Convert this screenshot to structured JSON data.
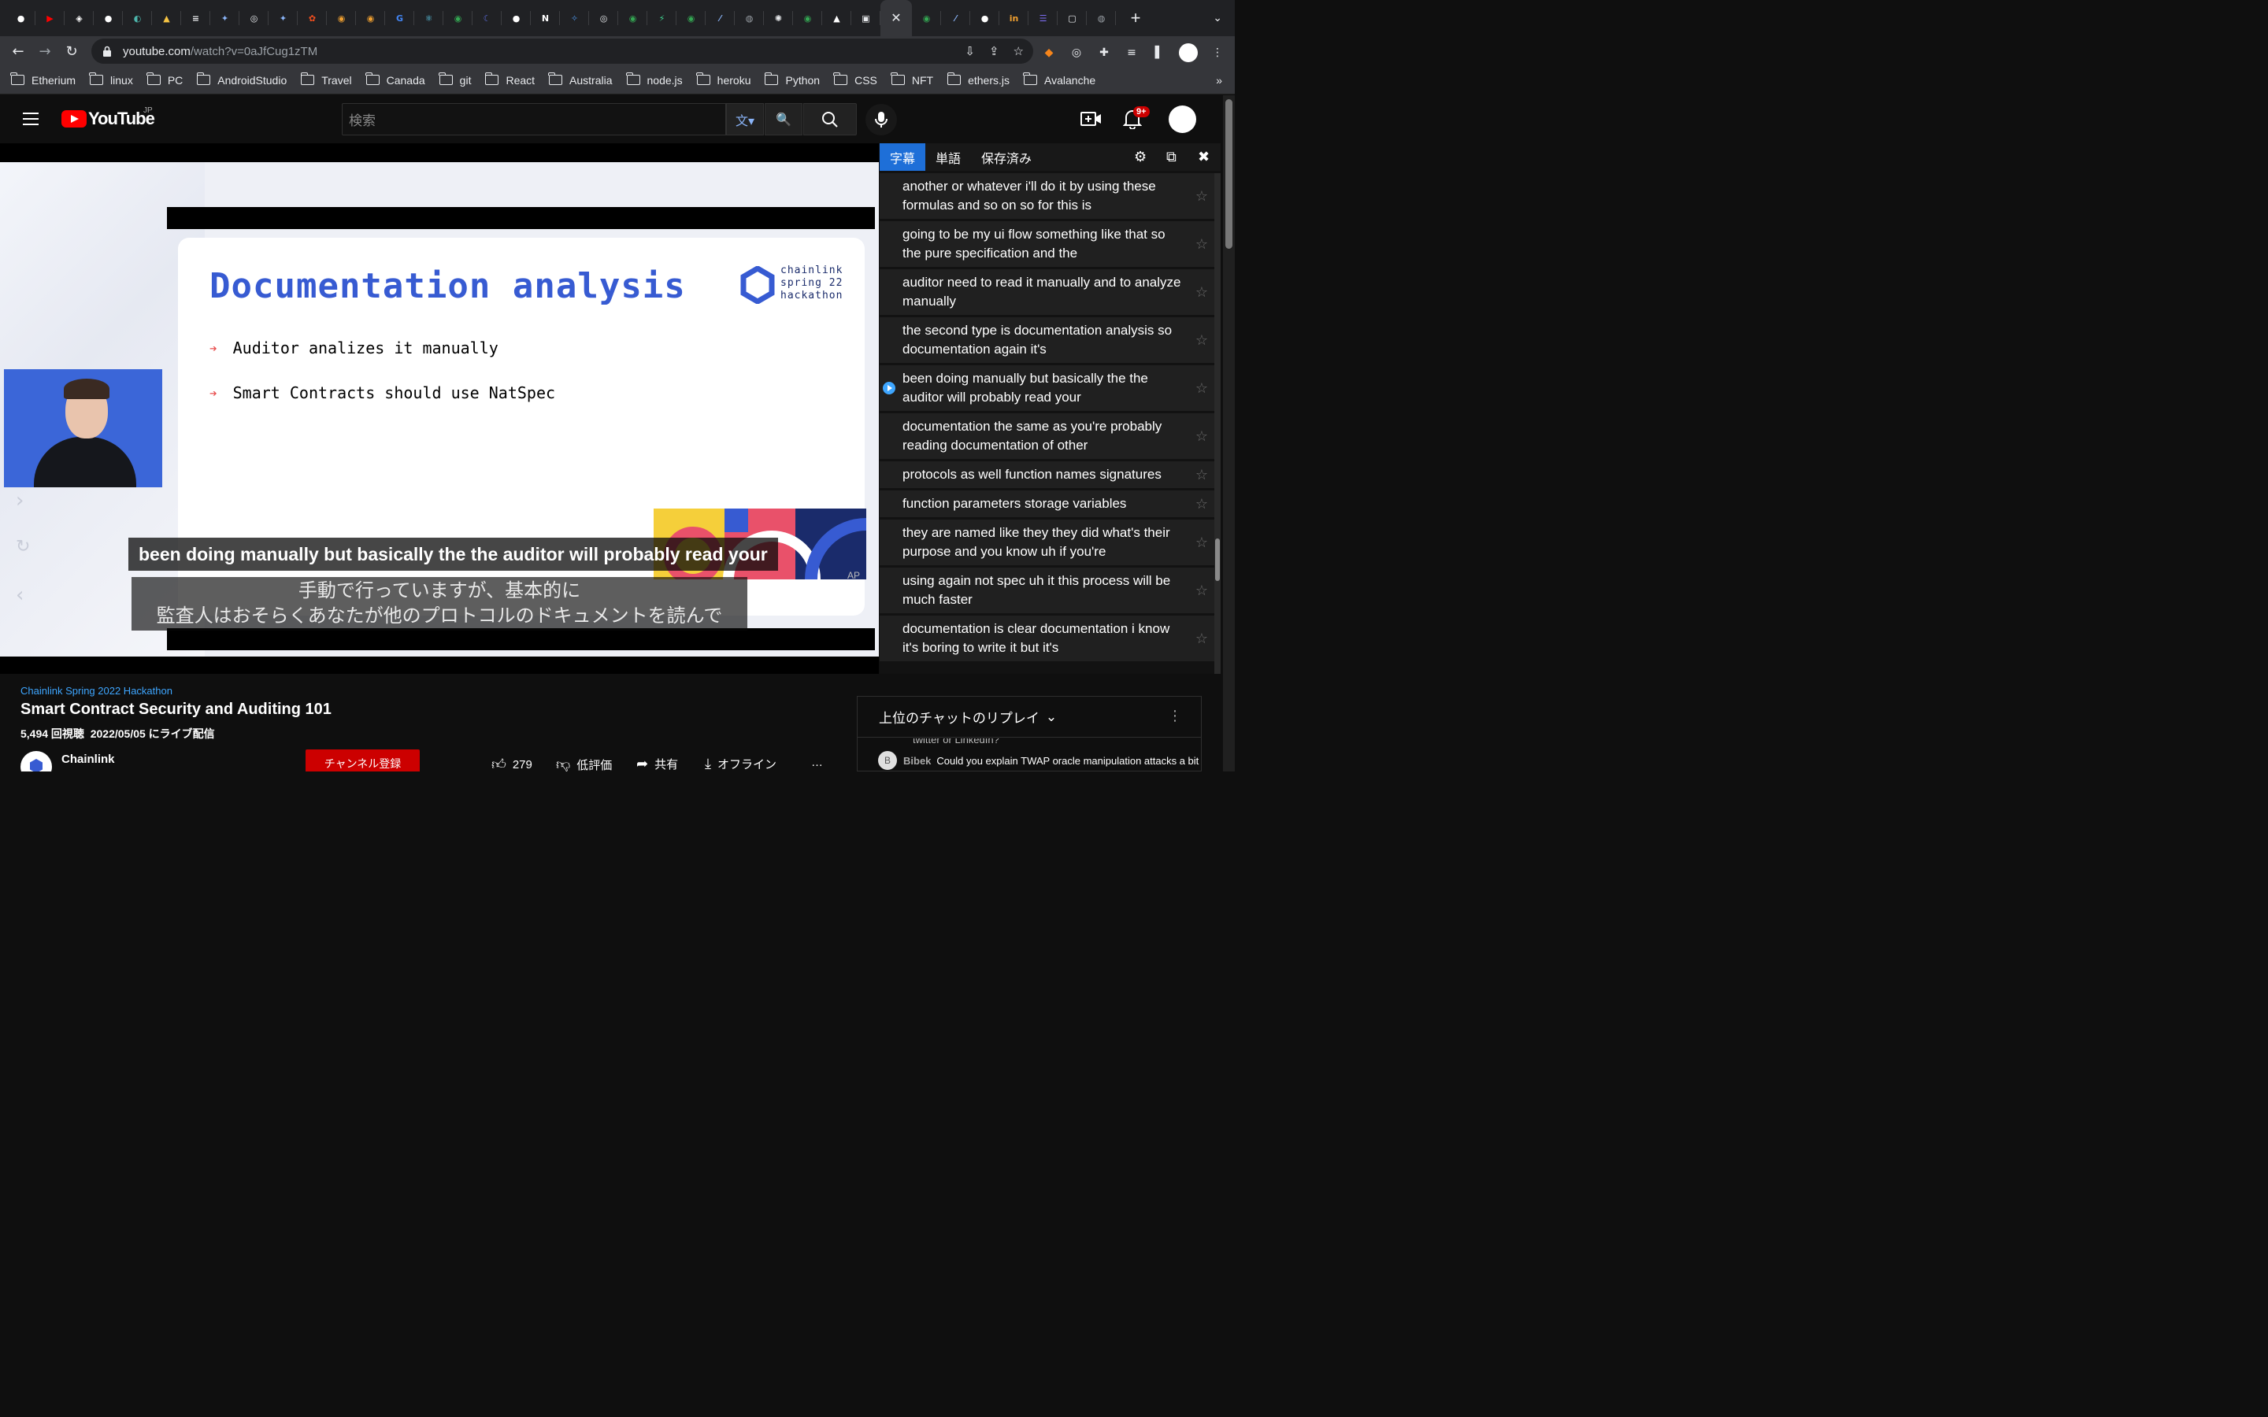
{
  "browser": {
    "url_host": "youtube.com",
    "url_path": "/watch?v=0aJfCug1zTM",
    "tabs": [
      {
        "icon": "github-icon",
        "color": "#ffffff"
      },
      {
        "icon": "youtube-icon",
        "color": "#ff0000"
      },
      {
        "icon": "codesandbox-icon",
        "color": "#ffffff"
      },
      {
        "icon": "github-icon",
        "color": "#ffffff"
      },
      {
        "icon": "chat-icon",
        "color": "#4db6ac"
      },
      {
        "icon": "warning-icon",
        "color": "#f6c343"
      },
      {
        "icon": "lines-icon",
        "color": "#e8eaed"
      },
      {
        "icon": "bluesky-icon",
        "color": "#8ab4f8"
      },
      {
        "icon": "chrome-icon",
        "color": "#e8eaed"
      },
      {
        "icon": "bluesky-icon",
        "color": "#8ab4f8"
      },
      {
        "icon": "figma-icon",
        "color": "#f24e1e"
      },
      {
        "icon": "donut-icon",
        "color": "#f0a030"
      },
      {
        "icon": "donut-icon",
        "color": "#f0a030"
      },
      {
        "icon": "google-icon",
        "color": "#4285f4"
      },
      {
        "icon": "react-icon",
        "color": "#61dafb"
      },
      {
        "icon": "green-circle-icon",
        "color": "#34a853"
      },
      {
        "icon": "moon-icon",
        "color": "#5a6ad8"
      },
      {
        "icon": "github-icon",
        "color": "#ffffff"
      },
      {
        "icon": "notion-icon",
        "color": "#ffffff"
      },
      {
        "icon": "compass-icon",
        "color": "#4a90e2"
      },
      {
        "icon": "chrome-icon",
        "color": "#e8eaed"
      },
      {
        "icon": "green-circle-icon",
        "color": "#34a853"
      },
      {
        "icon": "bolt-icon",
        "color": "#3ecf8e"
      },
      {
        "icon": "green-circle-icon",
        "color": "#34a853"
      },
      {
        "icon": "slash-icon",
        "color": "#8ab4f8"
      },
      {
        "icon": "globe-icon",
        "color": "#9aa0a6"
      },
      {
        "icon": "color-wheel-icon",
        "color": "#e8eaed"
      },
      {
        "icon": "green-circle-icon",
        "color": "#34a853"
      },
      {
        "icon": "triangle-icon",
        "color": "#ffffff"
      },
      {
        "icon": "image-icon",
        "color": "#e8eaed"
      }
    ],
    "tabs_after": [
      {
        "icon": "green-circle-icon",
        "color": "#34a853"
      },
      {
        "icon": "slash-icon",
        "color": "#8ab4f8"
      },
      {
        "icon": "github-icon",
        "color": "#ffffff"
      },
      {
        "icon": "in-icon",
        "color": "#f0a030"
      },
      {
        "icon": "list-icon",
        "color": "#7c6cf0"
      },
      {
        "icon": "square-icon",
        "color": "#e8eaed"
      },
      {
        "icon": "globe-icon",
        "color": "#9aa0a6"
      }
    ],
    "bookmarks": [
      "Etherium",
      "linux",
      "PC",
      "AndroidStudio",
      "Travel",
      "Canada",
      "git",
      "React",
      "Australia",
      "node.js",
      "heroku",
      "Python",
      "CSS",
      "NFT",
      "ethers.js",
      "Avalanche"
    ],
    "bookmarks_more": "»"
  },
  "youtube": {
    "logo_text": "YouTube",
    "region": "JP",
    "search_placeholder": "検索",
    "notif_count": "9+"
  },
  "slide": {
    "title": "Documentation analysis",
    "brand_lines": [
      "chainlink",
      "spring 22",
      "hackathon"
    ],
    "bullets": [
      "Auditor analizes it manually",
      "Smart Contracts should use NatSpec"
    ]
  },
  "captions": {
    "english": "been doing manually but basically the the auditor will probably read your",
    "japanese_line1": "手動で行っていますが、基本的に",
    "japanese_line2": "監査人はおそらくあなたが他のプロトコルのドキュメントを読んで",
    "ap": "AP"
  },
  "panel": {
    "tabs": [
      "字幕",
      "単語",
      "保存済み"
    ],
    "subtitles": [
      {
        "text": "another or whatever i'll do it by using these formulas and so on so for this is",
        "active": false
      },
      {
        "text": "going to be my ui flow something like that so the pure specification and the",
        "active": false
      },
      {
        "text": "auditor need to read it manually and to analyze manually",
        "active": false
      },
      {
        "text": "the second type is documentation analysis so documentation again it's",
        "active": false
      },
      {
        "text": "been doing manually but basically the the auditor will probably read your",
        "active": true
      },
      {
        "text": "documentation the same as you're probably reading documentation of other",
        "active": false
      },
      {
        "text": "protocols as well function names signatures",
        "active": false
      },
      {
        "text": "function parameters storage variables",
        "active": false
      },
      {
        "text": "they are named like they they did what's their purpose and you know uh if you're",
        "active": false
      },
      {
        "text": "using again not spec uh it this process will be much faster",
        "active": false
      },
      {
        "text": "documentation is clear documentation i know it's boring to write it but it's",
        "active": false
      }
    ]
  },
  "video": {
    "hashtag": "Chainlink Spring 2022 Hackathon",
    "title": "Smart Contract Security and Auditing 101",
    "views": "5,494 回視聴",
    "date": "2022/05/05 にライブ配信",
    "channel": "Chainlink",
    "subscribe": "チャンネル登録",
    "likes": "279",
    "dislike": "低評価",
    "share": "共有",
    "offline": "オフライン",
    "more": "…"
  },
  "chat": {
    "header": "上位のチャットのリプレイ",
    "prev_line": "twitter or LinkedIn?",
    "author_initial": "B",
    "author": "Bibek",
    "message": "Could you explain TWAP oracle manipulation attacks a bit more or point out some"
  }
}
